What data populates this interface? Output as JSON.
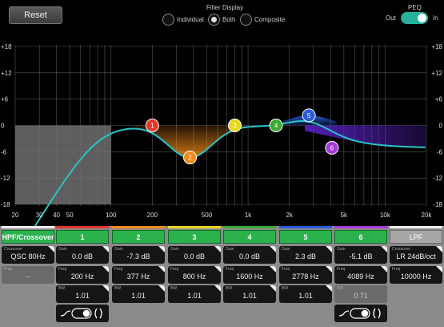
{
  "toolbar": {
    "reset_label": "Reset"
  },
  "filter_display": {
    "title": "Filter Display",
    "options": [
      "Individual",
      "Both",
      "Composite"
    ],
    "selected": "Both"
  },
  "peq": {
    "title": "PEQ",
    "out_label": "Out",
    "in_label": "In",
    "enabled": true
  },
  "graph": {
    "y_ticks": [
      "+18",
      "+12",
      "+6",
      "0",
      "-6",
      "-12",
      "-18"
    ],
    "x_ticks": [
      "20",
      "30",
      "40",
      "50",
      "100",
      "200",
      "500",
      "1k",
      "2k",
      "5k",
      "10k",
      "20k"
    ],
    "colors": {
      "curve": "#29c4c8",
      "crossover_region": "#6e6e6e",
      "grid": "#9a9a9a"
    },
    "nodes": [
      {
        "label": "1",
        "freq_hz": 200,
        "gain_db": 0.0,
        "color": "#e03a2a"
      },
      {
        "label": "2",
        "freq_hz": 377,
        "gain_db": -7.3,
        "color": "#f08a1c"
      },
      {
        "label": "3",
        "freq_hz": 800,
        "gain_db": 0.0,
        "color": "#e6d81e"
      },
      {
        "label": "4",
        "freq_hz": 1600,
        "gain_db": 0.0,
        "color": "#3aaa35"
      },
      {
        "label": "5",
        "freq_hz": 2778,
        "gain_db": 2.3,
        "color": "#2a5cdc"
      },
      {
        "label": "6",
        "freq_hz": 4089,
        "gain_db": -5.1,
        "color": "#a53ad6"
      }
    ]
  },
  "hpf": {
    "button_label": "HPF/Crossover",
    "crossover_label": "Crossover",
    "crossover_value": "QSC 80Hz",
    "freq_label": "Freq",
    "freq_value": "--"
  },
  "lpf": {
    "button_label": "LPF",
    "crossover_label": "Crossover",
    "crossover_value": "LR 24dB/oct",
    "freq_label": "Freq",
    "freq_value": "10000 Hz"
  },
  "bands": [
    {
      "label": "1",
      "color": "#e03a2a",
      "gain_label": "Gain",
      "gain": "0.0 dB",
      "freq_label": "Freq",
      "freq": "200 Hz",
      "bw_label": "BW",
      "bw": "1.01"
    },
    {
      "label": "2",
      "color": "#f08a1c",
      "gain_label": "Gain",
      "gain": "-7.3 dB",
      "freq_label": "Freq",
      "freq": "377 Hz",
      "bw_label": "BW",
      "bw": "1.01"
    },
    {
      "label": "3",
      "color": "#e6d81e",
      "gain_label": "Gain",
      "gain": "0.0 dB",
      "freq_label": "Freq",
      "freq": "800 Hz",
      "bw_label": "BW",
      "bw": "1.01"
    },
    {
      "label": "4",
      "color": "#3aaa35",
      "gain_label": "Gain",
      "gain": "0.0 dB",
      "freq_label": "Freq",
      "freq": "1600 Hz",
      "bw_label": "BW",
      "bw": "1.01"
    },
    {
      "label": "5",
      "color": "#2a5cdc",
      "gain_label": "Gain",
      "gain": "2.3 dB",
      "freq_label": "Freq",
      "freq": "2778 Hz",
      "bw_label": "BW",
      "bw": "1.01"
    },
    {
      "label": "6",
      "color": "#a53ad6",
      "gain_label": "Gain",
      "gain": "-5.1 dB",
      "freq_label": "Freq",
      "freq": "4089 Hz",
      "bw_label": "BW",
      "bw": "0.71"
    }
  ]
}
